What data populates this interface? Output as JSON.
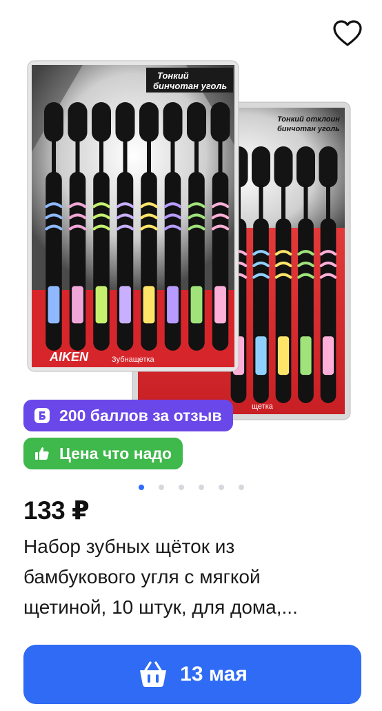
{
  "product": {
    "image_alt": "Набор зубных щёток из бамбукового угля",
    "package_text_front": [
      "Тонкий",
      "бинчотан уголь"
    ],
    "package_text_back": [
      "Тонкий отклоин",
      "бинчотан уголь"
    ],
    "package_brand": "AIKEN",
    "package_caption": "Зубнащетка",
    "package_caption_back": "щетка",
    "handle_colors": [
      "#8fb8ff",
      "#f1a6d8",
      "#c6f06e",
      "#c9b0ff",
      "#ffe46a",
      "#b79bff",
      "#9fe37a",
      "#ffb0d8"
    ],
    "back_handle_colors": [
      "#ffb0d8",
      "#8fd0ff",
      "#ffe46a",
      "#9fe37a",
      "#ffb0d8"
    ]
  },
  "favorite": {
    "icon": "heart-icon"
  },
  "badges": {
    "points": {
      "icon": "points-b-icon",
      "label": "200 баллов за отзыв",
      "color": "#6a47e8"
    },
    "price_good": {
      "icon": "thumb-up-icon",
      "label": "Цена что надо",
      "color": "#3fb84c"
    }
  },
  "gallery": {
    "total": 6,
    "active": 1
  },
  "price": "133 ₽",
  "title_lines": [
    "Набор зубных щёток из",
    "бамбукового угля с мягкой",
    "щетиной, 10 штук, для дома,..."
  ],
  "buy_button": {
    "icon": "basket-icon",
    "label": "13 мая",
    "color": "#2f6bf5"
  }
}
